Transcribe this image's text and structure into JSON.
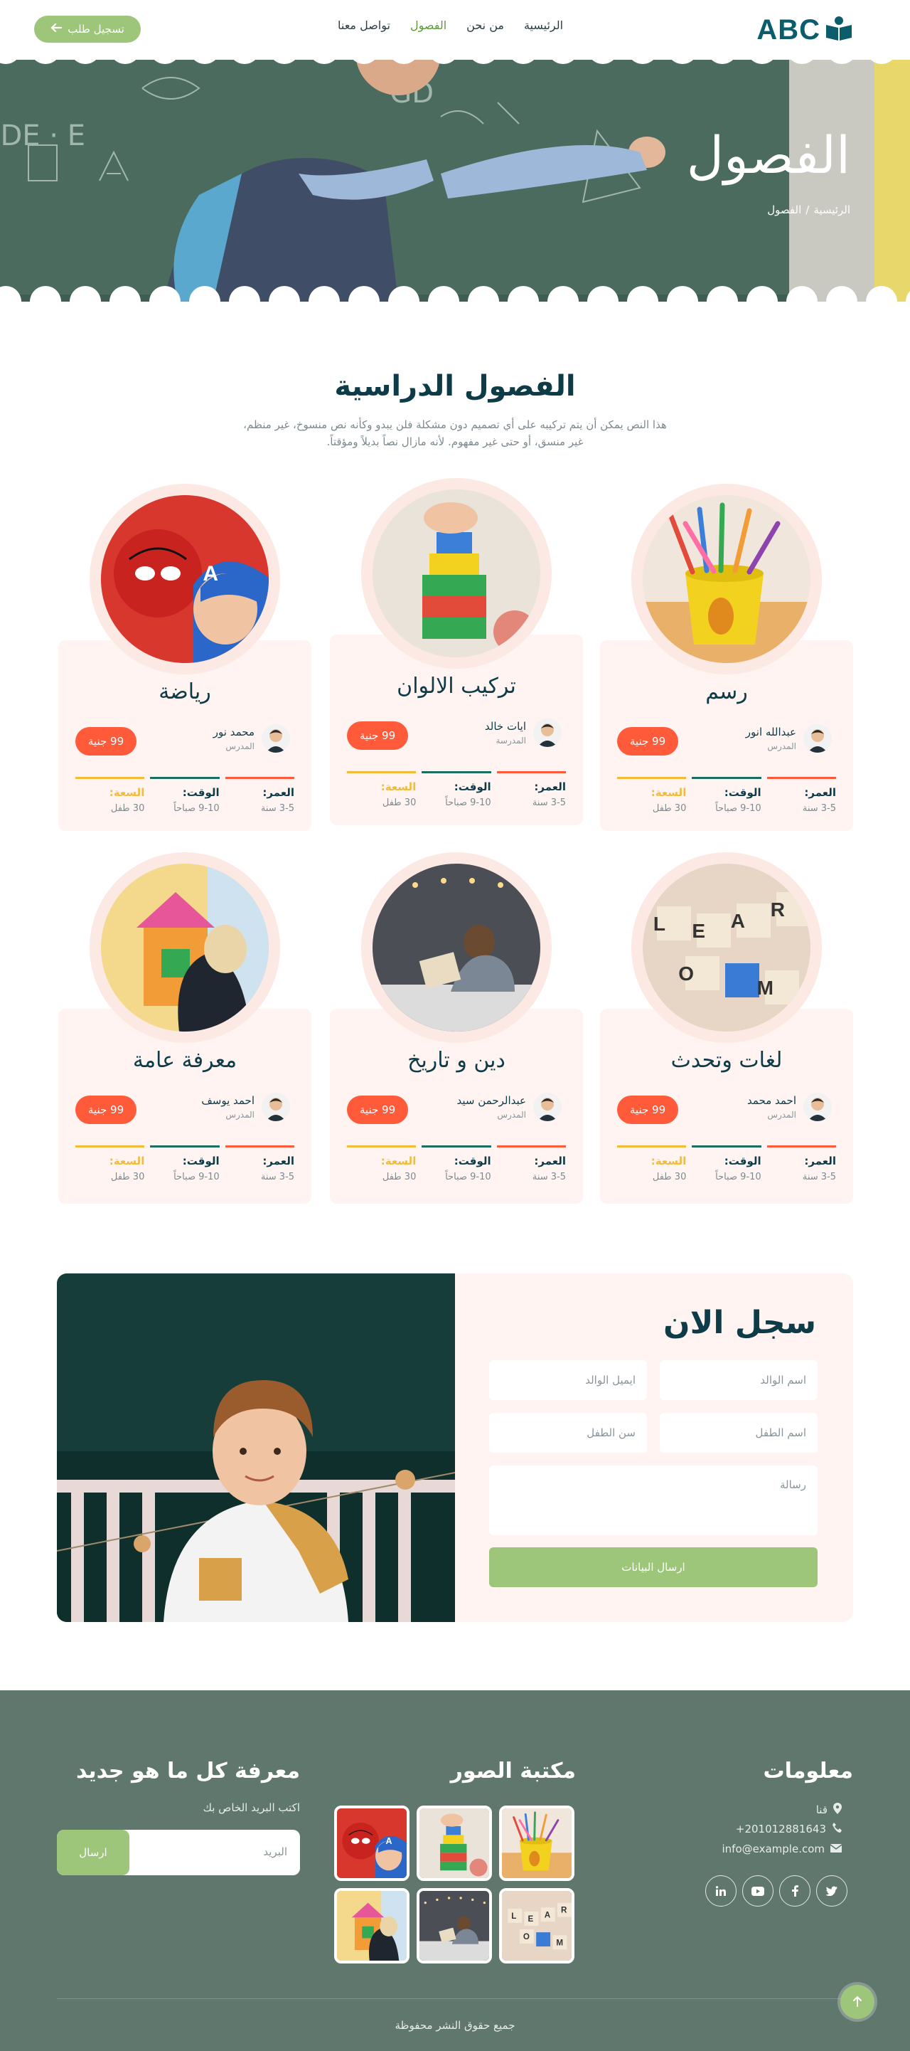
{
  "nav": {
    "logo_text": "ABC",
    "links": [
      "الرئيسية",
      "من نحن",
      "الفصول",
      "تواصل معنا"
    ],
    "active_link": "الفصول",
    "register_label": "تسجيل طلب"
  },
  "hero": {
    "title": "الفصول",
    "breadcrumb_home": "الرئيسية",
    "breadcrumb_sep": "/",
    "breadcrumb_current": "الفصول"
  },
  "section": {
    "title": "الفصول الدراسية",
    "description": "هذا النص يمكن أن يتم تركيبه على أي تصميم دون مشكلة فلن يبدو وكأنه نص منسوخ، غير منظم، غير منسق، أو حتى غير مفهوم. لأنه مازال نصاً بديلاً ومؤقتاً."
  },
  "labels": {
    "age": "العمر:",
    "time": "الوقت:",
    "capacity": "السعة:"
  },
  "classes": [
    {
      "title": "رسم",
      "teacher": "عبدالله انور",
      "role": "المدرس",
      "price": "99 جنية",
      "age": "3-5 سنة",
      "time": "9-10 صباحاً",
      "capacity": "30 طفل"
    },
    {
      "title": "تركيب الالوان",
      "teacher": "ايات خالد",
      "role": "المدرسة",
      "price": "99 جنية",
      "age": "3-5 سنة",
      "time": "9-10 صباحاً",
      "capacity": "30 طفل"
    },
    {
      "title": "رياضة",
      "teacher": "محمد نور",
      "role": "المدرس",
      "price": "99 جنية",
      "age": "3-5 سنة",
      "time": "9-10 صباحاً",
      "capacity": "30 طفل"
    },
    {
      "title": "لغات وتحدث",
      "teacher": "احمد محمد",
      "role": "المدرس",
      "price": "99 جنية",
      "age": "3-5 سنة",
      "time": "9-10 صباحاً",
      "capacity": "30 طفل"
    },
    {
      "title": "دين و تاريخ",
      "teacher": "عبدالرحمن سيد",
      "role": "المدرس",
      "price": "99 جنية",
      "age": "3-5 سنة",
      "time": "9-10 صباحاً",
      "capacity": "30 طفل"
    },
    {
      "title": "معرفة عامة",
      "teacher": "احمد يوسف",
      "role": "المدرس",
      "price": "99 جنية",
      "age": "3-5 سنة",
      "time": "9-10 صباحاً",
      "capacity": "30 طفل"
    }
  ],
  "register": {
    "title": "سجل الان",
    "parent_name": "اسم الوالد",
    "parent_email": "ايميل الوالد",
    "child_name": "اسم الطفل",
    "child_age": "سن الطفل",
    "message": "رسالة",
    "submit": "ارسال البيانات"
  },
  "footer": {
    "info_title": "معلومات",
    "location": "قنا",
    "phone": "201012881643+",
    "email": "info@example.com",
    "gallery_title": "مكتبة الصور",
    "newsletter_title": "معرفة كل ما هو جديد",
    "newsletter_sub": "اكتب البريد الخاص بك",
    "newsletter_placeholder": "البريد",
    "newsletter_button": "ارسال",
    "copyright": "جميع حقوق النشر محفوظة"
  },
  "colors": {
    "accent_green": "#9ec67a",
    "price_red": "#ff5b3b",
    "dark_teal": "#0d3b48",
    "footer_bg": "#5f776d",
    "card_bg": "#fff4f1"
  }
}
